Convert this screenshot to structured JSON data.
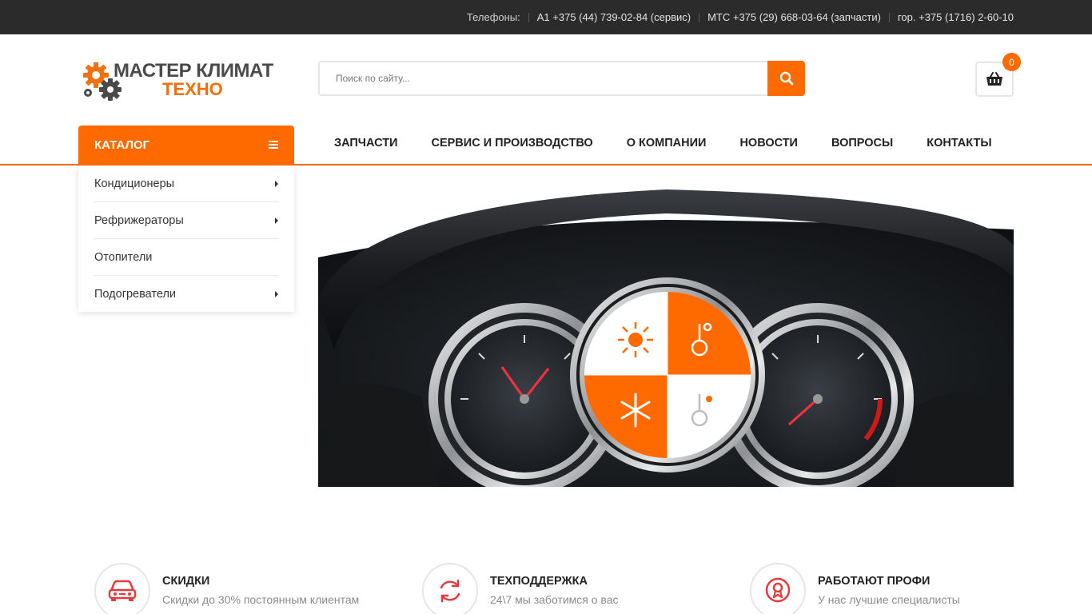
{
  "topbar": {
    "phones_label": "Телефоны:",
    "phone_a1": "А1 +375 (44) 739-02-84 (сервис)",
    "phone_mts": "МТС +375 (29) 668-03-64 (запчасти)",
    "phone_city": "гор. +375 (1716) 2-60-10"
  },
  "logo": {
    "line1": "МАСТЕР КЛИМАТ",
    "line2": "ТЕХНО"
  },
  "search": {
    "placeholder": "Поиск по сайту..."
  },
  "cart": {
    "count": "0"
  },
  "catalog": {
    "label": "КАТАЛОГ",
    "items": [
      {
        "label": "Кондиционеры",
        "has_sub": true
      },
      {
        "label": "Рефрижераторы",
        "has_sub": true
      },
      {
        "label": "Отопители",
        "has_sub": false
      },
      {
        "label": "Подогреватели",
        "has_sub": true
      }
    ]
  },
  "nav": {
    "items": [
      "ЗАПЧАСТИ",
      "СЕРВИС И ПРОИЗВОДСТВО",
      "О КОМПАНИИ",
      "НОВОСТИ",
      "ВОПРОСЫ",
      "КОНТАКТЫ"
    ]
  },
  "features": [
    {
      "title": "СКИДКИ",
      "desc": "Скидки до 30% постоянным клиентам",
      "icon": "car-icon"
    },
    {
      "title": "ТЕХПОДДЕРЖКА",
      "desc": "24\\7 мы заботимся о вас",
      "icon": "refresh-icon"
    },
    {
      "title": "РАБОТАЮТ ПРОФИ",
      "desc": "У нас лучшие специалисты",
      "icon": "award-icon"
    }
  ],
  "colors": {
    "accent": "#ff6a00",
    "topbar": "#2b2b2b",
    "feature_icon": "#e8393f"
  }
}
